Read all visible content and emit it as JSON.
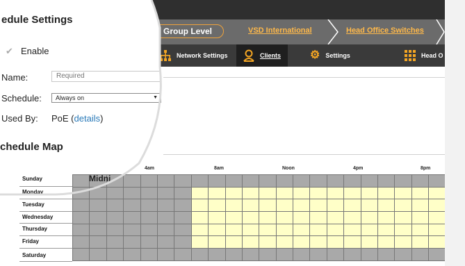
{
  "breadcrumb": {
    "group_level": "Group Level",
    "org": "VSD International",
    "network": "Head Office Switches"
  },
  "nav": {
    "tabs": [
      {
        "label": "Network Settings",
        "icon": "network-icon"
      },
      {
        "label": "Clients",
        "icon": "person-icon"
      },
      {
        "label": "Settings",
        "icon": "gear-icon"
      },
      {
        "label": "Head O",
        "icon": "grid-icon"
      }
    ],
    "accent": "#f5a623"
  },
  "schedule_settings": {
    "title": "edule Settings",
    "enable_label": "Enable",
    "enable_checked": true,
    "name_label": "Name:",
    "name_placeholder": "Required",
    "schedule_label": "Schedule:",
    "schedule_value": "Always on",
    "used_by_label": "Used By:",
    "used_by_value": "PoE (",
    "used_by_link": "details",
    "used_by_close": ")"
  },
  "schedule_map": {
    "title": "chedule Map",
    "midnight_label": "Midni",
    "time_labels": [
      "4am",
      "8am",
      "Noon",
      "4pm",
      "8pm"
    ],
    "days": [
      "Sunday",
      "Monday",
      "Tuesday",
      "Wednesday",
      "Thursday",
      "Friday",
      "Saturday"
    ],
    "on_color": "#ffffc8",
    "off_color": "#a9a9a9"
  }
}
